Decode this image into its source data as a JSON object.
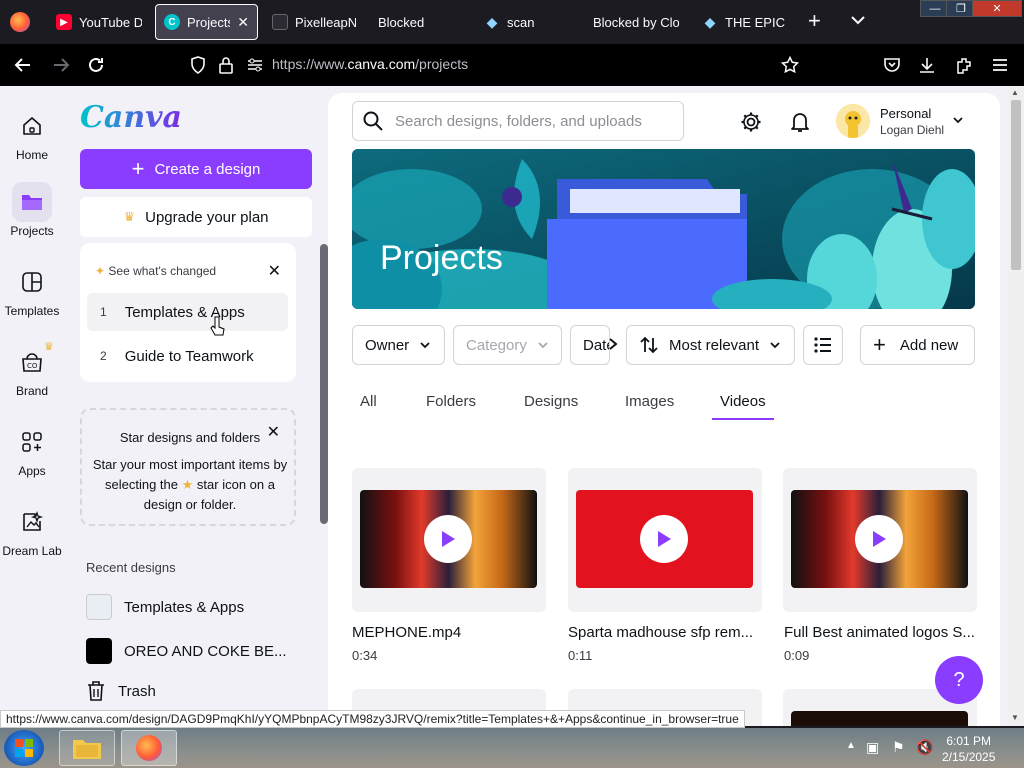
{
  "browser": {
    "tabs": [
      {
        "label": "YouTube Do",
        "icon": "youtube-icon",
        "color": "#ff0033"
      },
      {
        "label": "Projects -",
        "icon": "canva-icon",
        "color": "#7d2ae8",
        "active": true
      },
      {
        "label": "PixelleapNet",
        "icon": "pixelleap-icon",
        "color": "#1c1b22"
      },
      {
        "label": "Blocked",
        "icon": "blocked-icon",
        "color": "#1c1b22"
      },
      {
        "label": "scan",
        "icon": "scan-icon",
        "color": "#1c1b22"
      },
      {
        "label": "Blocked by Clou",
        "icon": "cloud-icon",
        "color": "#1c1b22"
      },
      {
        "label": "THE EPICNE",
        "icon": "epic-icon",
        "color": "#1c1b22"
      }
    ],
    "close_tab": "✕",
    "new_tab": "+",
    "url_prefix": "https://www.",
    "url_host": "canva.com",
    "url_path": "/projects",
    "status_url": "https://www.canva.com/design/DAGD9PmqKhI/yYQMPbnpACyTM98zy3JRVQ/remix?title=Templates+&+Apps&continue_in_browser=true"
  },
  "rail": {
    "items": [
      {
        "label": "Home",
        "icon": "home-icon"
      },
      {
        "label": "Projects",
        "icon": "folder-icon",
        "active": true
      },
      {
        "label": "Templates",
        "icon": "templates-icon"
      },
      {
        "label": "Brand",
        "icon": "brand-icon"
      },
      {
        "label": "Apps",
        "icon": "apps-icon"
      },
      {
        "label": "Dream Lab",
        "icon": "dreamlab-icon"
      }
    ]
  },
  "sidebar": {
    "logo": "Canva",
    "create_label": "Create a design",
    "upgrade_label": "Upgrade your plan",
    "whats_changed": {
      "title": "See what's changed",
      "items": [
        {
          "num": "1",
          "label": "Templates & Apps"
        },
        {
          "num": "2",
          "label": "Guide to Teamwork"
        }
      ]
    },
    "star_card": {
      "title": "Star designs and folders",
      "body_before": "Star your most important items by selecting the",
      "body_after": "star icon on a design or folder."
    },
    "recent_heading": "Recent designs",
    "recent": [
      {
        "label": "Templates & Apps"
      },
      {
        "label": "OREO AND COKE BE..."
      }
    ],
    "trash_label": "Trash"
  },
  "main": {
    "search_placeholder": "Search designs, folders, and uploads",
    "account_name": "Personal",
    "account_user": "Logan Diehl",
    "banner_title": "Projects",
    "filters": {
      "owner": "Owner",
      "category": "Category",
      "date": "Date",
      "sort": "Most relevant",
      "add_new": "Add new"
    },
    "tabs": [
      "All",
      "Folders",
      "Designs",
      "Images",
      "Videos"
    ],
    "active_tab": "Videos",
    "videos": [
      {
        "title": "MEPHONE.mp4",
        "duration": "0:34"
      },
      {
        "title": "Sparta madhouse sfp rem...",
        "duration": "0:11"
      },
      {
        "title": "Full Best animated logos S...",
        "duration": "0:09"
      }
    ],
    "help_label": "?"
  },
  "taskbar": {
    "time": "6:01 PM",
    "date": "2/15/2025"
  },
  "colors": {
    "accent": "#8b3dff",
    "rail_bg": "#f2f1f7",
    "browser_bg": "#1c1b22"
  }
}
